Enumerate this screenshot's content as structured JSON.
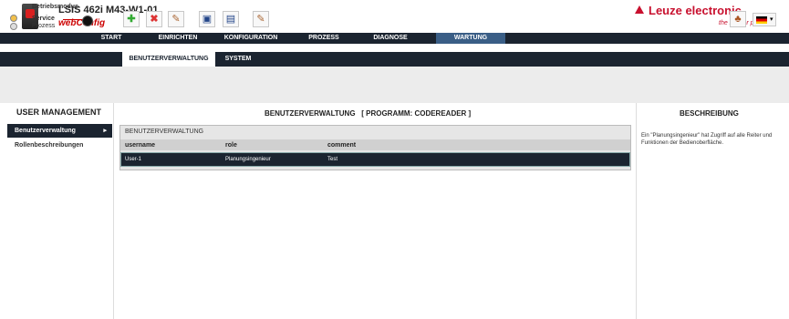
{
  "header": {
    "device_name": "LSIS 462i M43-W1-01",
    "app_name": "webConfig",
    "brand": "Leuze electronic",
    "tagline": "the sensor people"
  },
  "main_nav": {
    "tabs": [
      {
        "label": "START"
      },
      {
        "label": "EINRICHTEN"
      },
      {
        "label": "KONFIGURATION"
      },
      {
        "label": "PROZESS"
      },
      {
        "label": "DIAGNOSE"
      },
      {
        "label": "WARTUNG",
        "active": true
      }
    ]
  },
  "sub_nav": {
    "tabs": [
      {
        "label": "BENUTZERVERWALTUNG",
        "active": true
      },
      {
        "label": "SYSTEM"
      }
    ]
  },
  "operating_mode": {
    "title": "Betriebsmodus",
    "service_label": "Service",
    "process_label": "Prozess"
  },
  "left_panel": {
    "title": "USER MANAGEMENT",
    "items": [
      {
        "label": "Benutzerverwaltung",
        "active": true
      },
      {
        "label": "Rollenbeschreibungen"
      }
    ]
  },
  "main": {
    "title": "BENUTZERVERWALTUNG   [ PROGRAMM: CODEREADER ]",
    "table": {
      "title": "BENUTZERVERWALTUNG",
      "columns": [
        "username",
        "role",
        "comment"
      ],
      "rows": [
        [
          "User-1",
          "Planungsingenieur",
          "Test"
        ]
      ]
    }
  },
  "right_panel": {
    "title": "BESCHREIBUNG",
    "text": "Ein \"Planungsingenieur\" hat Zugriff auf alle Reiter und Funktionen der Bedienoberfläche."
  },
  "colors": {
    "nav_bg": "#1b2430",
    "active_tab": "#3a5e86",
    "brand": "#c8102e"
  }
}
